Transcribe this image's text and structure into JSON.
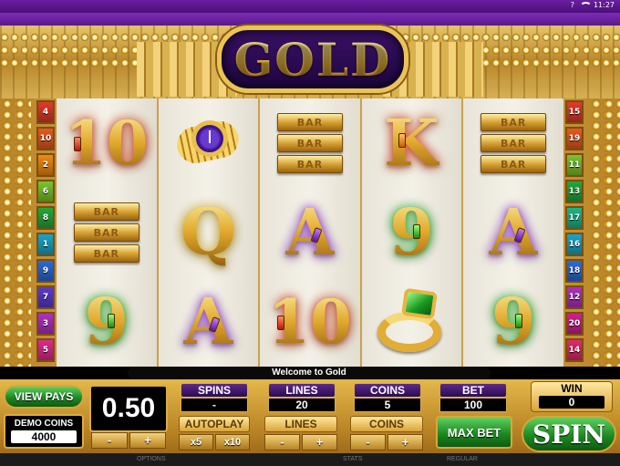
{
  "status_bar": {
    "help_label": "?",
    "time": "11:27"
  },
  "logo": {
    "title": "GOLD"
  },
  "paylines_left": [
    {
      "num": "4",
      "color": "#e03b2a"
    },
    {
      "num": "10",
      "color": "#e85a20"
    },
    {
      "num": "2",
      "color": "#f08a10"
    },
    {
      "num": "6",
      "color": "#7bc42a"
    },
    {
      "num": "8",
      "color": "#22a83a"
    },
    {
      "num": "1",
      "color": "#18a6c8"
    },
    {
      "num": "9",
      "color": "#2a6ad8"
    },
    {
      "num": "7",
      "color": "#5a3ad0"
    },
    {
      "num": "3",
      "color": "#b030c0"
    },
    {
      "num": "5",
      "color": "#e02a8a"
    }
  ],
  "paylines_right": [
    {
      "num": "15",
      "color": "#e03b2a"
    },
    {
      "num": "19",
      "color": "#e85a20"
    },
    {
      "num": "11",
      "color": "#7bc42a"
    },
    {
      "num": "13",
      "color": "#22a83a"
    },
    {
      "num": "17",
      "color": "#18b88a"
    },
    {
      "num": "16",
      "color": "#18a6c8"
    },
    {
      "num": "18",
      "color": "#2a6ad8"
    },
    {
      "num": "12",
      "color": "#b030c0"
    },
    {
      "num": "20",
      "color": "#d0208a"
    },
    {
      "num": "14",
      "color": "#e02a6a"
    }
  ],
  "reels": [
    [
      {
        "symbol": "10",
        "type": "ten",
        "icon": "ten-red-gem"
      },
      {
        "symbol": "BAR",
        "type": "bars",
        "icon": "triple-bar"
      },
      {
        "symbol": "9",
        "type": "nine",
        "icon": "nine-green-gem"
      }
    ],
    [
      {
        "symbol": "watch",
        "type": "watch",
        "icon": "gold-watch"
      },
      {
        "symbol": "Q",
        "type": "queen",
        "icon": "queen-yellow"
      },
      {
        "symbol": "A",
        "type": "ace",
        "icon": "ace-purple-gem"
      }
    ],
    [
      {
        "symbol": "BAR",
        "type": "bars",
        "icon": "triple-bar"
      },
      {
        "symbol": "A",
        "type": "ace",
        "icon": "ace-purple-gem"
      },
      {
        "symbol": "10",
        "type": "ten",
        "icon": "ten-red-gem"
      }
    ],
    [
      {
        "symbol": "K",
        "type": "king",
        "icon": "king-orange-gem"
      },
      {
        "symbol": "9",
        "type": "nine",
        "icon": "nine-green-gem"
      },
      {
        "symbol": "ring",
        "type": "ring",
        "icon": "emerald-ring"
      }
    ],
    [
      {
        "symbol": "BAR",
        "type": "bars",
        "icon": "triple-bar"
      },
      {
        "symbol": "A",
        "type": "ace",
        "icon": "ace-purple-gem"
      },
      {
        "symbol": "9",
        "type": "nine",
        "icon": "nine-green-gem"
      }
    ]
  ],
  "bar_text": "BAR",
  "message": "Welcome to Gold",
  "controls": {
    "view_pays": "VIEW PAYS",
    "demo_coins_label": "DEMO COINS",
    "demo_coins_value": "4000",
    "coin_value": "0.50",
    "minus": "-",
    "plus": "+",
    "spins_label": "SPINS",
    "spins_value": "-",
    "autoplay_label": "AUTOPLAY",
    "x5": "x5",
    "x10": "x10",
    "lines_label": "LINES",
    "lines_value": "20",
    "lines_label_2": "LINES",
    "coins_label": "COINS",
    "coins_value": "5",
    "coins_label_2": "COINS",
    "bet_label": "BET",
    "bet_value": "100",
    "max_bet": "MAX BET",
    "win_label": "WIN",
    "win_value": "0",
    "spin": "SPIN"
  },
  "footer": {
    "options": "OPTIONS",
    "stats": "STATS",
    "regular": "REGULAR"
  }
}
